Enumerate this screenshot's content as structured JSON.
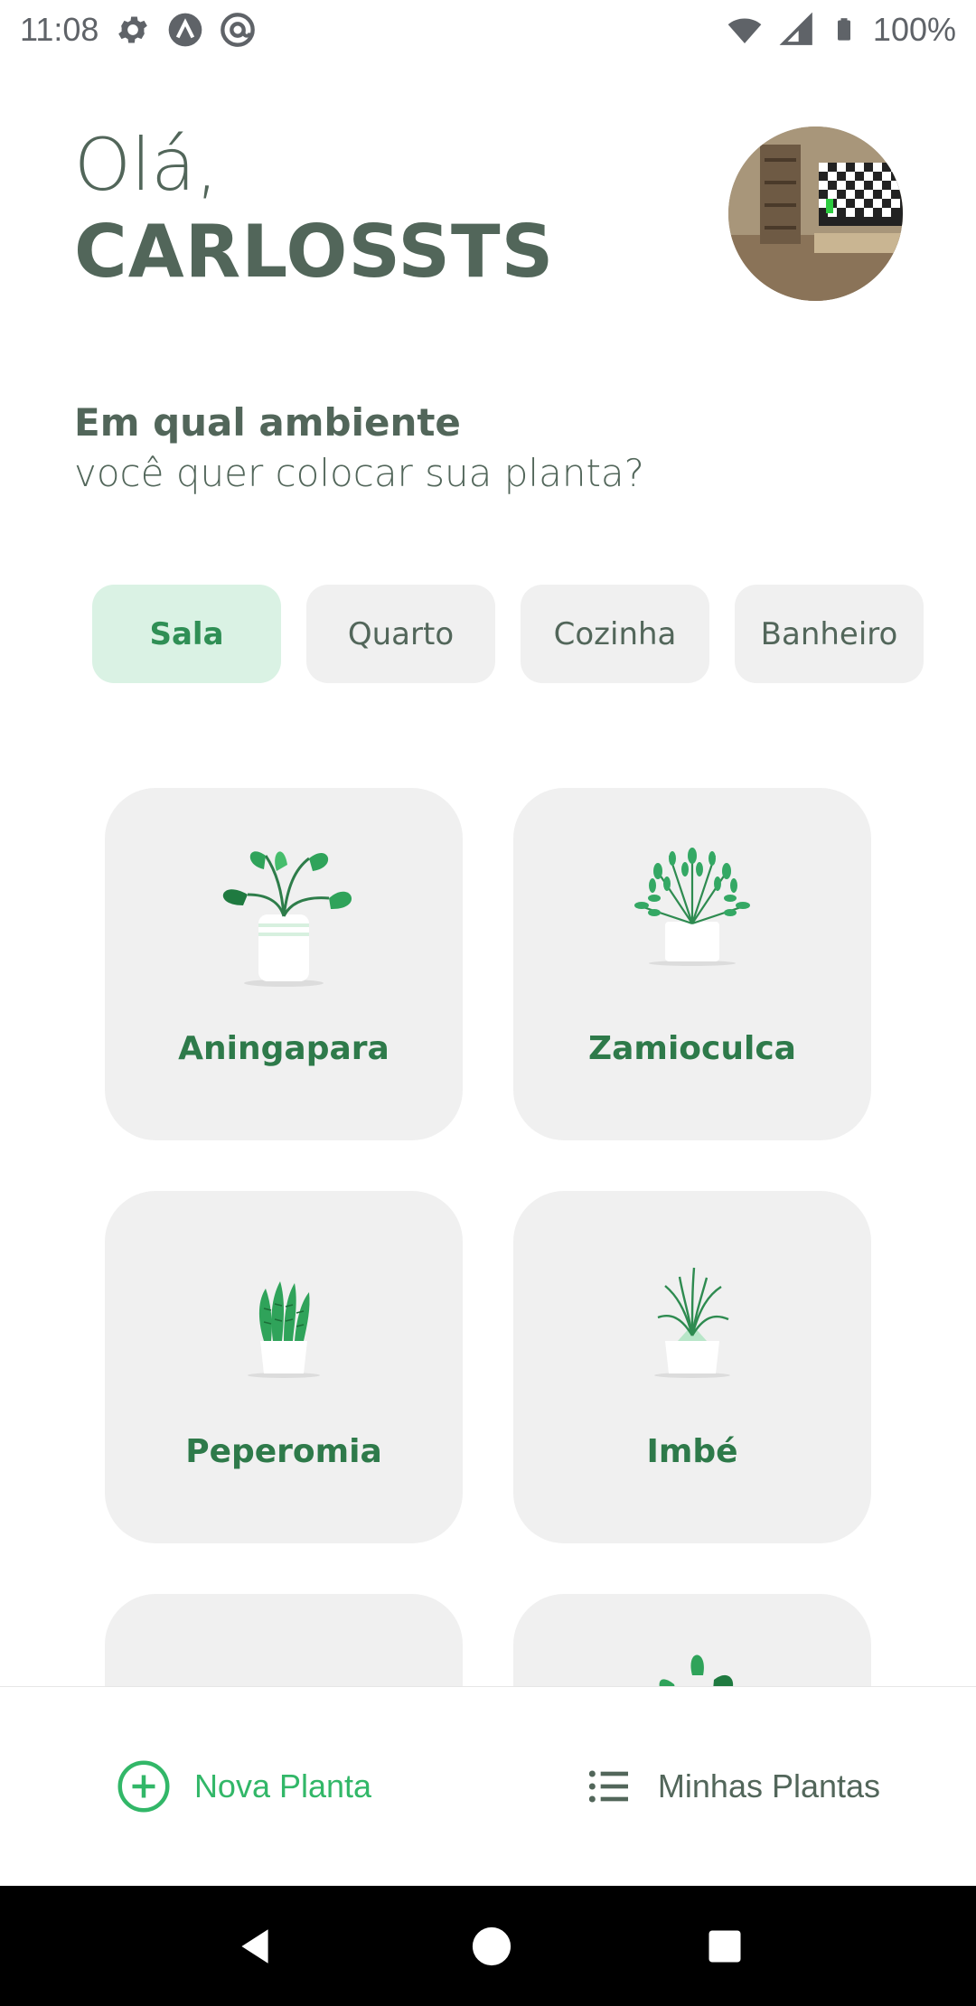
{
  "status_bar": {
    "time": "11:08",
    "battery": "100%",
    "icons": [
      "settings-icon",
      "app-a-icon",
      "app-at-icon",
      "wifi-icon",
      "signal-icon",
      "battery-icon"
    ]
  },
  "greeting": {
    "hello": "Olá,",
    "name": "CARLOSSTS"
  },
  "question": {
    "line1": "Em qual ambiente",
    "line2": "você quer colocar sua planta?"
  },
  "environments": [
    {
      "label": "Sala",
      "selected": true
    },
    {
      "label": "Quarto",
      "selected": false
    },
    {
      "label": "Cozinha",
      "selected": false
    },
    {
      "label": "Banheiro",
      "selected": false
    }
  ],
  "plants": [
    {
      "name": "Aningapara"
    },
    {
      "name": "Zamioculca"
    },
    {
      "name": "Peperomia"
    },
    {
      "name": "Imbé"
    }
  ],
  "tabs": {
    "new_plant": "Nova Planta",
    "my_plants": "Minhas Plantas"
  },
  "colors": {
    "heading": "#52665A",
    "green": "#32B768",
    "green_light": "#DAF2E4",
    "card_bg": "#F0F0F0"
  }
}
